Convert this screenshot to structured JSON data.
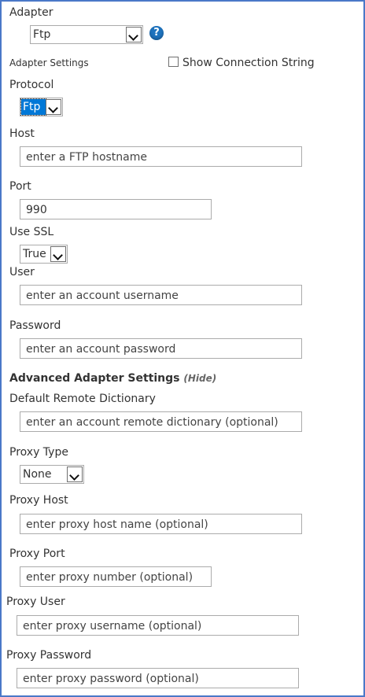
{
  "adapter": {
    "label": "Adapter",
    "value": "Ftp",
    "help_icon": "question-circle-icon"
  },
  "adapter_settings": {
    "label": "Adapter Settings",
    "show_connection_string_label": "Show Connection String",
    "show_connection_string_checked": false
  },
  "protocol": {
    "label": "Protocol",
    "value": "Ftp"
  },
  "host": {
    "label": "Host",
    "placeholder": "enter a FTP hostname"
  },
  "port": {
    "label": "Port",
    "value": "990"
  },
  "use_ssl": {
    "label": "Use SSL",
    "value": "True"
  },
  "user": {
    "label": "User",
    "placeholder": "enter an account username"
  },
  "password": {
    "label": "Password",
    "placeholder": "enter an account password"
  },
  "advanced": {
    "title": "Advanced Adapter Settings",
    "hide_link": "(Hide)"
  },
  "default_remote_dictionary": {
    "label": "Default Remote Dictionary",
    "placeholder": "enter an account remote dictionary (optional)"
  },
  "proxy_type": {
    "label": "Proxy Type",
    "value": "None"
  },
  "proxy_host": {
    "label": "Proxy Host",
    "placeholder": "enter proxy host name (optional)"
  },
  "proxy_port": {
    "label": "Proxy Port",
    "placeholder": "enter proxy number (optional)"
  },
  "proxy_user": {
    "label": "Proxy User",
    "placeholder": "enter proxy username (optional)"
  },
  "proxy_password": {
    "label": "Proxy Password",
    "placeholder": "enter proxy password (optional)"
  },
  "colors": {
    "frame_border": "#4a78c8",
    "selection": "#0078d7",
    "help_icon": "#1e73be"
  }
}
